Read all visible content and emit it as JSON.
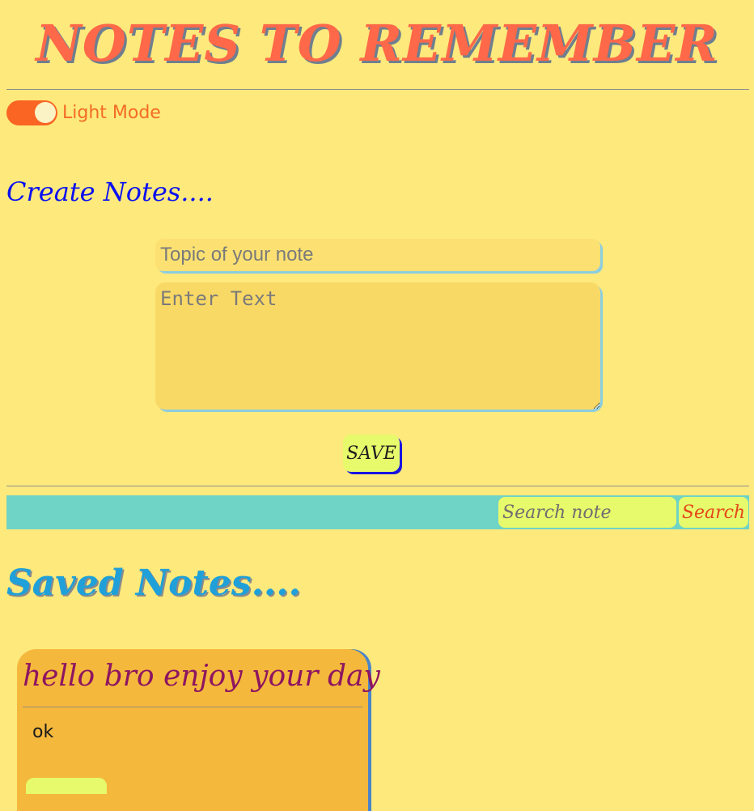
{
  "app": {
    "title": "NOTES TO REMEMBER"
  },
  "theme_toggle": {
    "label": "Light Mode",
    "checked": true
  },
  "create": {
    "heading": "Create Notes....",
    "topic_placeholder": "Topic of your note",
    "topic_value": "",
    "text_placeholder": "Enter Text",
    "text_value": "",
    "save_label": "SAVE"
  },
  "search": {
    "placeholder": "Search note",
    "value": "",
    "button_label": "Search"
  },
  "saved": {
    "heading": "Saved Notes....",
    "notes": [
      {
        "title": "hello bro enjoy your day",
        "body": "ok"
      }
    ]
  },
  "colors": {
    "background": "#fde97c",
    "title": "#ff6848",
    "toggle_track": "#fa6523",
    "create_heading": "#0a10f0",
    "saved_heading": "#1fa0d8",
    "search_bar": "#6fd3c6",
    "button": "#e6fa6b",
    "note_card": "#f4b83c",
    "note_title": "#8e1560"
  }
}
